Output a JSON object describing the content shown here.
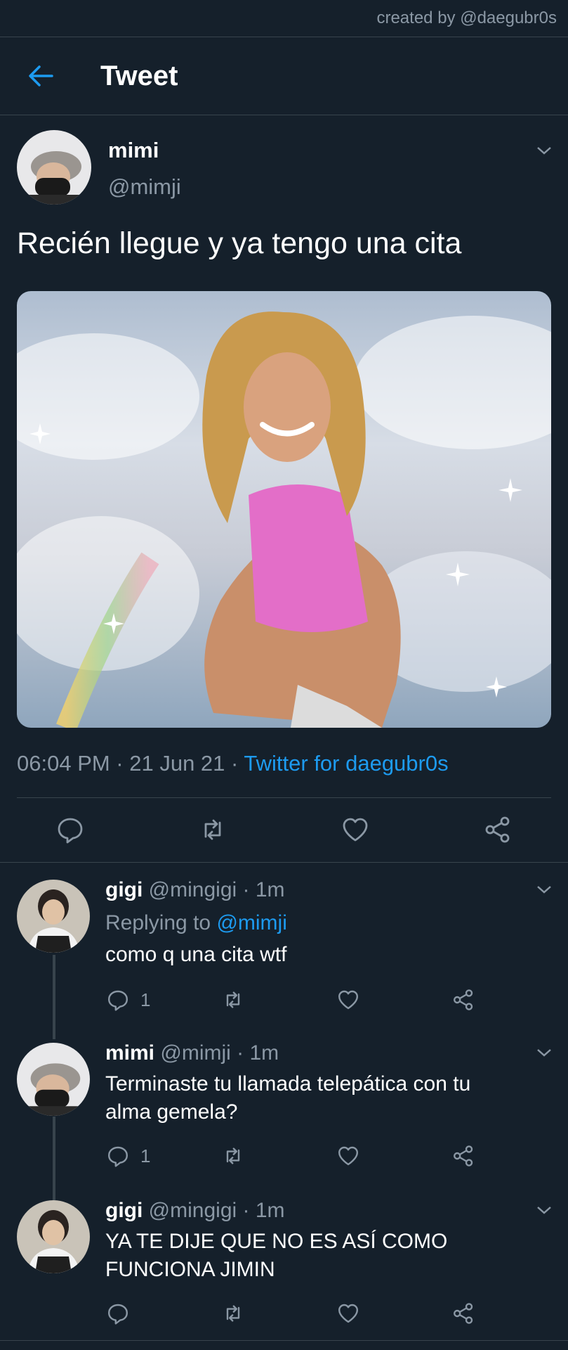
{
  "watermark": "created by @daegubr0s",
  "header": {
    "title": "Tweet",
    "back_icon": "arrow-left-icon"
  },
  "tweet": {
    "name": "mimi",
    "handle": "@mimji",
    "text": "Recién llegue y ya tengo una cita",
    "time": "06:04 PM · 21 Jun 21 ·",
    "source": "Twitter for daegubr0s",
    "actions": [
      "reply-icon",
      "retweet-icon",
      "like-icon",
      "share-icon"
    ]
  },
  "replies": [
    {
      "name": "gigi",
      "meta": "@mingigi · 1m",
      "replying_prefix": "Replying to",
      "replying_to": "@mimji",
      "lines": [
        "como q una cita wtf"
      ],
      "reply_count": "1"
    },
    {
      "name": "mimi",
      "meta": "@mimji · 1m",
      "lines": [
        "Terminaste tu llamada telepática con tu",
        "alma gemela?"
      ],
      "reply_count": "1"
    },
    {
      "name": "gigi",
      "meta": "@mingigi · 1m",
      "lines": [
        "YA TE DIJE QUE NO ES ASÍ COMO",
        "FUNCIONA JIMIN"
      ],
      "reply_count": ""
    }
  ],
  "colors": {
    "background": "#15202b",
    "accent": "#1d9bf0",
    "muted": "#8b98a5",
    "divider": "#38444d"
  }
}
